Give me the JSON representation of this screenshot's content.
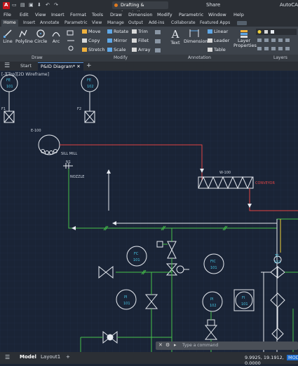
{
  "app": {
    "logo_text": "A",
    "title": "AutoCA",
    "workspace": "Drafting & Annotation",
    "share": "Share",
    "quick_access": [
      "▭",
      "▤",
      "▣",
      "⬇",
      "↶",
      "↷"
    ]
  },
  "menu": [
    "File",
    "Edit",
    "View",
    "Insert",
    "Format",
    "Tools",
    "Draw",
    "Dimension",
    "Modify",
    "Parametric",
    "Window",
    "Help"
  ],
  "ribbon_tabs": [
    "Home",
    "Insert",
    "Annotate",
    "Parametric",
    "View",
    "Manage",
    "Output",
    "Add-ins",
    "Collaborate",
    "Featured Apps"
  ],
  "ribbon": {
    "draw": [
      "Line",
      "Polyline",
      "Circle",
      "Arc"
    ],
    "modify": [
      "Move",
      "Rotate",
      "Trim",
      "Copy",
      "Mirror",
      "Fillet",
      "Stretch",
      "Scale",
      "Array"
    ],
    "annotation": [
      "Text",
      "Dimension",
      "Linear",
      "Leader",
      "Table"
    ],
    "layers": [
      "Layer",
      "Properties"
    ],
    "panels": [
      "Draw",
      "Modify",
      "Annotation",
      "Layers"
    ]
  },
  "doc_tabs": [
    "Start",
    "P&ID Diagram*"
  ],
  "viewport_label": "[-][Top][2D Wireframe]",
  "drawing": {
    "tags": [
      "FE",
      "101",
      "FE",
      "102",
      "F1",
      "F2",
      "E-100",
      "SILL MILL",
      "N1",
      "NOZZLE",
      "W-100",
      "CONVEYOR",
      "FC",
      "101",
      "FIC",
      "101",
      "PI",
      "101",
      "PI",
      "102",
      "FI",
      "101",
      "TC",
      "101"
    ]
  },
  "command": {
    "placeholder": "Type a command",
    "close": "✕",
    "wrench": "🔧",
    "chevron": "▸"
  },
  "status": {
    "tabs": [
      "Model",
      "Layout1"
    ],
    "add": "+",
    "coordinates": "9.9925, 19.1912, 0.0000",
    "mode": "MODEL"
  }
}
